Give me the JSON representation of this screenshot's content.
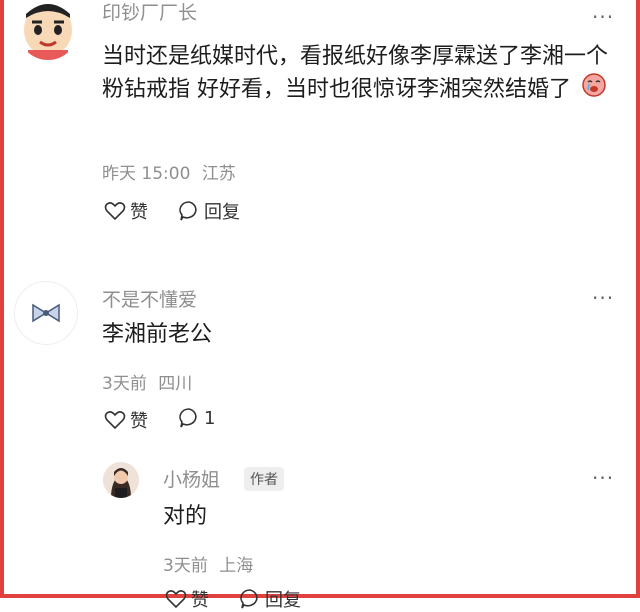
{
  "comments": [
    {
      "username": "印钞厂厂长",
      "content": "当时还是纸媒时代，看报纸好像李厚霖送了李湘一个粉钻戒指 好好看，当时也很惊讶李湘突然结婚了",
      "emoji": "cry-emoji",
      "time": "昨天 15:00",
      "location": "江苏",
      "like_label": "赞",
      "reply_label": "回复"
    },
    {
      "username": "不是不懂爱",
      "content": "李湘前老公",
      "time": "3天前",
      "location": "四川",
      "like_label": "赞",
      "reply_count": "1"
    }
  ],
  "reply": {
    "username": "小杨姐",
    "badge": "作者",
    "content": "对的",
    "time": "3天前",
    "location": "上海",
    "like_label": "赞",
    "reply_label": "回复"
  },
  "more_label": "···",
  "colors": {
    "frame": "#e0413f",
    "muted": "#8f8f8f",
    "text": "#1d1d1d"
  }
}
